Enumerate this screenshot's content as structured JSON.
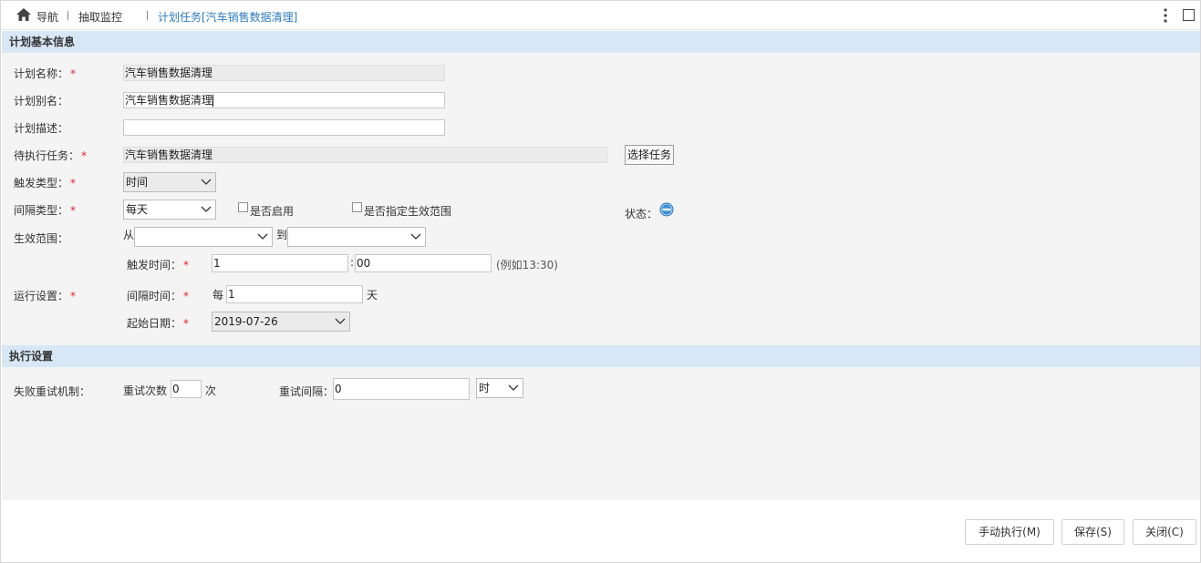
{
  "breadcrumb": {
    "nav_label": "导航",
    "monitor_label": "抽取监控",
    "current_label": "计划任务[汽车销售数据清理]"
  },
  "sections": {
    "basic_info": "计划基本信息",
    "exec_settings": "执行设置"
  },
  "form": {
    "plan_name_label": "计划名称：",
    "plan_name_value": "汽车销售数据清理",
    "plan_alias_label": "计划别名：",
    "plan_alias_value": "汽车销售数据清理",
    "plan_desc_label": "计划描述：",
    "plan_desc_value": "",
    "pending_task_label": "待执行任务：",
    "pending_task_value": "汽车销售数据清理",
    "select_task_button": "选择任务",
    "trigger_type_label": "触发类型：",
    "trigger_type_value": "时间",
    "interval_type_label": "间隔类型：",
    "interval_type_value": "每天",
    "enable_label": "是否启用",
    "specify_range_label": "是否指定生效范围",
    "status_label": "状态：",
    "effective_range_label": "生效范围：",
    "from_label": "从",
    "to_label": "到",
    "from_value": "",
    "to_value": "",
    "run_settings_label": "运行设置：",
    "trigger_time_label": "触发时间：",
    "trigger_hour": "1",
    "time_colon": ":",
    "trigger_minute": "00",
    "trigger_example": "(例如13:30)",
    "interval_time_label": "间隔时间：",
    "every_label": "每",
    "interval_value": "1",
    "day_unit": "天",
    "start_date_label": "起始日期：",
    "start_date_value": "2019-07-26",
    "required_mark": "*"
  },
  "exec": {
    "retry_label": "失败重试机制：",
    "retry_count_label": "重试次数",
    "retry_count_value": "0",
    "retry_count_unit": "次",
    "retry_interval_label": "重试间隔：",
    "retry_interval_value": "0",
    "retry_interval_unit": "时"
  },
  "footer": {
    "manual_run": "手动执行(M)",
    "save": "保存(S)",
    "close": "关闭(C)"
  },
  "colors": {
    "section_header_bg": "#d7e7f5",
    "active_crumb": "#2a7bc1",
    "required": "#e0262a",
    "status_icon": "#2a7bc1"
  },
  "icons": [
    "home-icon",
    "more-vertical-icon",
    "maximize-icon",
    "chevron-down-icon",
    "status-disabled-icon"
  ]
}
